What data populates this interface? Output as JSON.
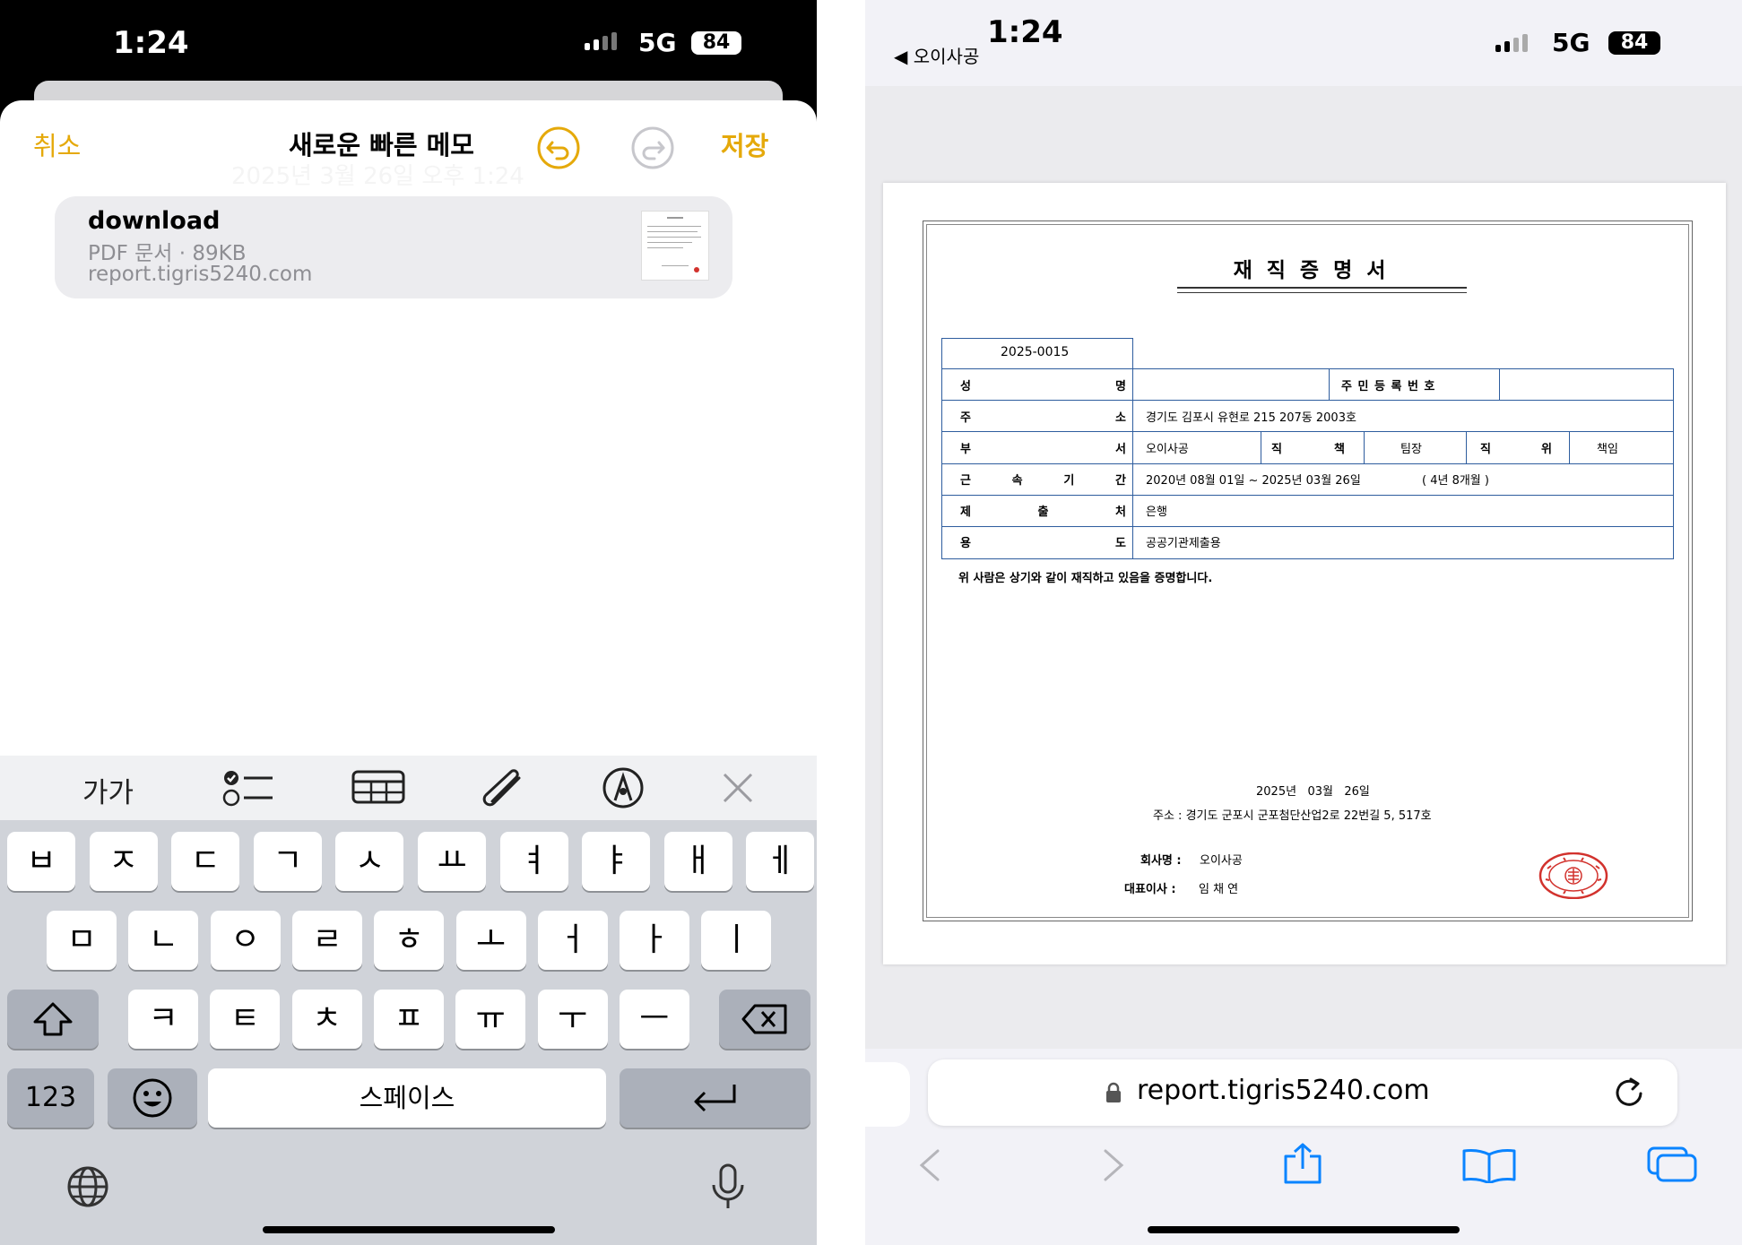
{
  "left": {
    "status": {
      "time": "1:24",
      "network": "5G",
      "battery": "84"
    },
    "memo": {
      "cancel": "취소",
      "title": "새로운 빠른 메모",
      "save": "저장",
      "faded_bg_text": "2025년 3월 26일 오후 1:24"
    },
    "attachment": {
      "name": "download",
      "meta": "PDF 문서 · 89KB",
      "domain": "report.tigris5240.com"
    },
    "toolbar": {
      "format_label": "가가"
    },
    "keyboard": {
      "row1": [
        "ㅂ",
        "ㅈ",
        "ㄷ",
        "ㄱ",
        "ㅅ",
        "ㅛ",
        "ㅕ",
        "ㅑ",
        "ㅐ",
        "ㅔ"
      ],
      "row2": [
        "ㅁ",
        "ㄴ",
        "ㅇ",
        "ㄹ",
        "ㅎ",
        "ㅗ",
        "ㅓ",
        "ㅏ",
        "ㅣ"
      ],
      "row3": [
        "ㅋ",
        "ㅌ",
        "ㅊ",
        "ㅍ",
        "ㅠ",
        "ㅜ",
        "ㅡ"
      ],
      "numbers": "123",
      "space": "스페이스"
    }
  },
  "right": {
    "status": {
      "time": "1:24",
      "back_app": "◀ 오이사공",
      "network": "5G",
      "battery": "84"
    },
    "document": {
      "title": "재 직 증 명 서",
      "doc_number": "2025-0015",
      "rows": {
        "name_label": "성 명",
        "resident_label": "주 민 등 록 번 호",
        "address_label": "주 소",
        "address_value": "경기도 김포시 유현로 215 207동 2003호",
        "dept_label": "부 서",
        "dept_value": "오이사공",
        "duty_label": "직 책",
        "duty_value": "팀장",
        "rank_label": "직 위",
        "rank_value": "책임",
        "period_label": "근 속 기 간",
        "period_value": "2020년 08월 01일 ~ 2025년 03월 26일",
        "period_extra": "( 4년 8개월 )",
        "submit_label": "제 출 처",
        "submit_value": "은행",
        "purpose_label": "용 도",
        "purpose_value": "공공기관제출용"
      },
      "statement": "위 사람은 상기와 같이 재직하고 있음을 증명합니다.",
      "date": "2025년   03월   26일",
      "company_address": "주소 : 경기도 군포시 군포첨단산업2로 22번길 5, 517호",
      "company_name_label": "회사명 :",
      "company_name": "오이사공",
      "ceo_label": "대표이사 :",
      "ceo_name": "임 채 연"
    },
    "browser": {
      "url": "report.tigris5240.com"
    }
  },
  "colors": {
    "accent_yellow": "#e5a90a",
    "table_blue": "#2e5d9e",
    "seal_red": "#d2322d"
  }
}
